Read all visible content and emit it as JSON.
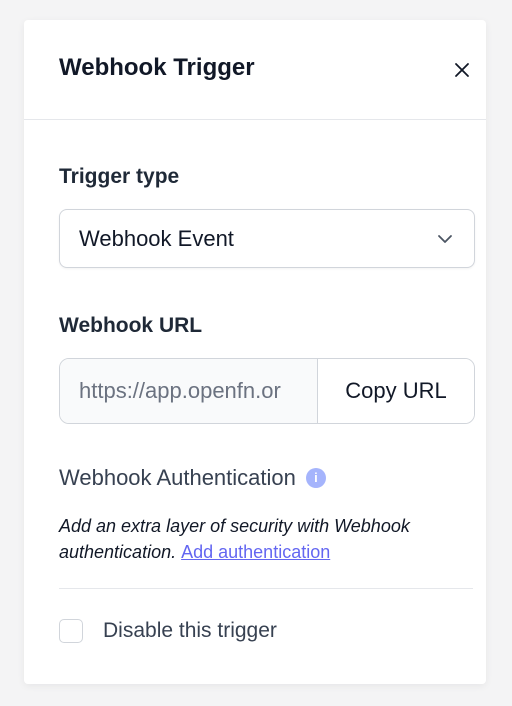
{
  "header": {
    "title": "Webhook Trigger"
  },
  "trigger_type": {
    "label": "Trigger type",
    "selected": "Webhook Event"
  },
  "webhook_url": {
    "label": "Webhook URL",
    "value": "https://app.openfn.or",
    "copy_label": "Copy URL"
  },
  "authentication": {
    "title": "Webhook Authentication",
    "info_icon": "i",
    "description": "Add an extra layer of security with Webhook authentication.",
    "link_label": "Add authentication"
  },
  "disable": {
    "label": "Disable this trigger",
    "checked": false
  },
  "colors": {
    "accent": "#6366f1",
    "info": "#a5b4fc"
  }
}
